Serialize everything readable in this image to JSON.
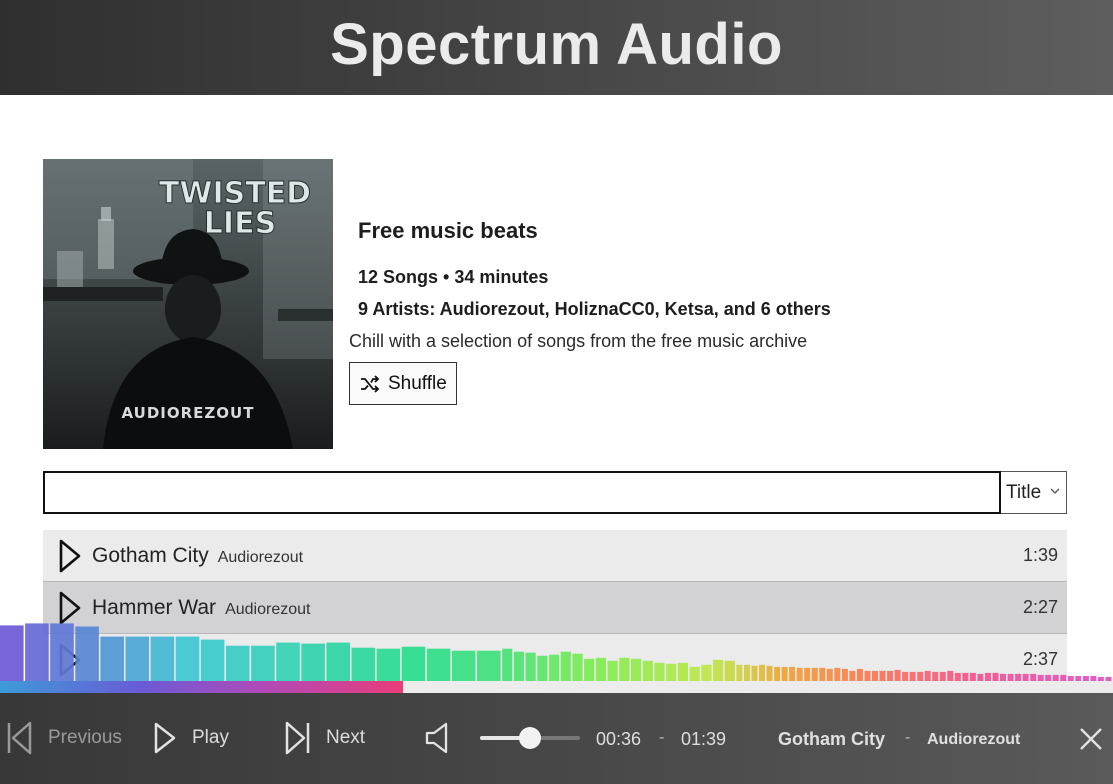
{
  "app": {
    "title": "Spectrum Audio"
  },
  "playlist": {
    "cover": {
      "text_line1": "TWISTED",
      "text_line2": "LIES",
      "label": "AUDIOREZOUT"
    },
    "title": "Free music beats",
    "stats": "12 Songs • 34 minutes",
    "artists": "9 Artists: Audiorezout, HoliznaCC0, Ketsa, and 6 others",
    "description": "Chill with a selection of songs from the free music archive",
    "shuffle_label": "Shuffle"
  },
  "search": {
    "value": "",
    "placeholder": "",
    "sort_selected": "Title"
  },
  "tracks": [
    {
      "title": "Gotham City",
      "artist": "Audiorezout",
      "duration": "1:39",
      "highlighted": false
    },
    {
      "title": "Hammer War",
      "artist": "Audiorezout",
      "duration": "2:27",
      "highlighted": true
    },
    {
      "title": "",
      "artist": "",
      "duration": "2:37",
      "highlighted": false
    }
  ],
  "spectrum": {
    "levels": [
      0.55,
      0.57,
      0.57,
      0.54,
      0.44,
      0.44,
      0.44,
      0.44,
      0.41,
      0.35,
      0.35,
      0.38,
      0.37,
      0.38,
      0.33,
      0.32,
      0.34,
      0.32,
      0.3,
      0.3,
      0.32,
      0.29,
      0.28,
      0.25,
      0.26,
      0.29,
      0.27,
      0.22,
      0.23,
      0.2,
      0.23,
      0.22,
      0.2,
      0.18,
      0.17,
      0.18,
      0.14,
      0.16,
      0.21,
      0.2,
      0.16,
      0.16,
      0.15,
      0.16,
      0.15,
      0.14,
      0.14,
      0.14,
      0.13,
      0.13,
      0.13,
      0.13,
      0.12,
      0.13,
      0.12,
      0.1,
      0.12,
      0.1,
      0.1,
      0.1,
      0.1,
      0.11,
      0.09,
      0.09,
      0.09,
      0.1,
      0.09,
      0.09,
      0.1,
      0.08,
      0.08,
      0.08,
      0.07,
      0.08,
      0.08,
      0.07,
      0.07,
      0.07,
      0.07,
      0.07,
      0.06,
      0.06,
      0.06,
      0.06,
      0.05,
      0.05,
      0.05,
      0.05,
      0.04,
      0.04
    ],
    "progress": 0.362
  },
  "player": {
    "prev_label": "Previous",
    "play_label": "Play",
    "next_label": "Next",
    "volume": 0.5,
    "current_time": "00:36",
    "time_sep": "-",
    "total_time": "01:39",
    "now_title": "Gotham City",
    "now_sep": "-",
    "now_artist": "Audiorezout"
  }
}
